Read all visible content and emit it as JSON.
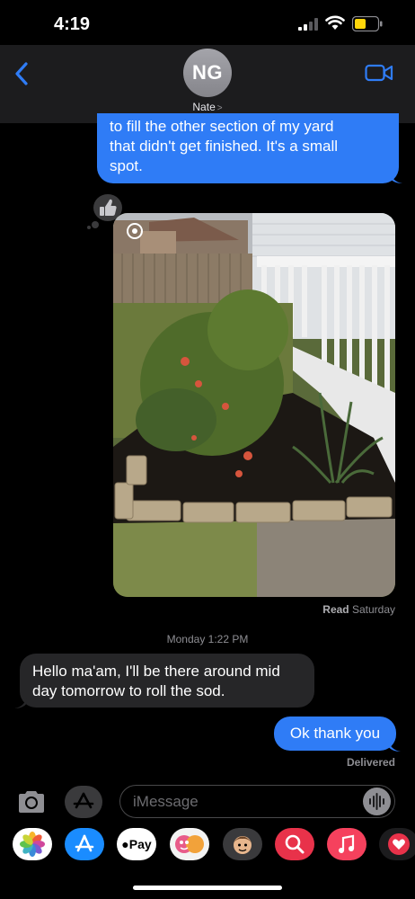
{
  "status_bar": {
    "time": "4:19"
  },
  "header": {
    "avatar_initials": "NG",
    "contact_name": "Nate",
    "contact_chevron": ">"
  },
  "messages": {
    "top_bubble_lines": [
      "to fill the other section of my yard",
      "that didn't get finished. It's a small",
      "spot."
    ],
    "read_receipt_label": "Read",
    "read_receipt_day": "Saturday",
    "date_separator": "Monday 1:22 PM",
    "incoming_lines": [
      "Hello ma'am, I'll be there around mid",
      "day tomorrow to roll the sod."
    ],
    "outgoing_last": "Ok thank you",
    "delivered": "Delivered"
  },
  "compose": {
    "placeholder": "iMessage"
  },
  "app_drawer": {
    "apple_pay_label": "Pay",
    "apps": [
      "photos-app-icon",
      "app-store-icon",
      "apple-pay-icon",
      "memoji-stickers-icon",
      "animoji-icon",
      "images-search-icon",
      "music-icon",
      "digital-touch-icon"
    ]
  },
  "colors": {
    "outgoing_bubble": "#2f7cf6",
    "incoming_bubble": "#262628",
    "accent": "#2f7cf6",
    "background": "#000000"
  }
}
